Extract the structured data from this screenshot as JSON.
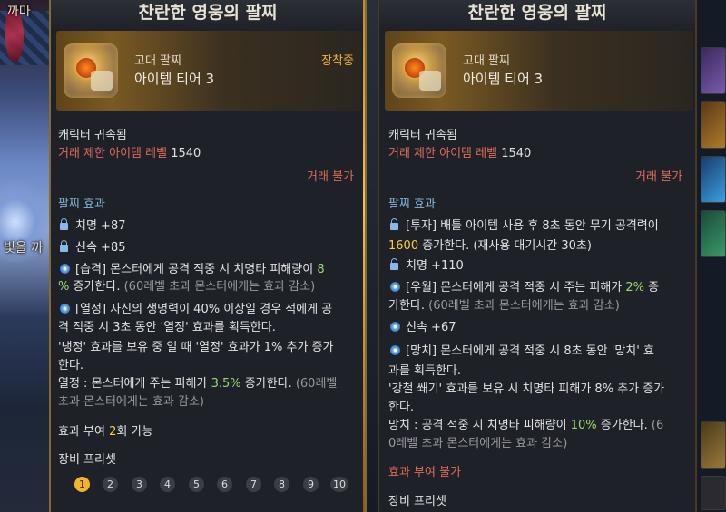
{
  "background": {
    "left_text_top": "까마",
    "left_text_mid": "빛을 까"
  },
  "left_panel": {
    "title": "찬란한 영웅의 팔찌",
    "grade": "고대 팔찌",
    "tier": "아이템 티어 3",
    "equipped": "장착중",
    "bound": "캐릭터 귀속됨",
    "trade_limit_label": "거래 제한 아이템 레벨",
    "trade_limit_value": "1540",
    "trade_status": "거래 불가",
    "effects_title": "팔찌 효과",
    "stat1": "치명 +87",
    "stat2": "신속 +85",
    "effect1_line1_a": "[습격] 몬스터에게 공격 적중 시 치명타 피해량이 ",
    "effect1_line1_b": "8",
    "effect1_line2_a": "%",
    "effect1_line2_b": " 증가한다.",
    "effect1_line2_c": " (60레벨 초과 몬스터에게는 효과 감소)",
    "effect2_line1": "[열정] 자신의 생명력이 40% 이상일 경우 적에게 공",
    "effect2_line2": "격 적중 시 3초 동안 '열정' 효과를 획득한다.",
    "effect2_line3": "'냉정' 효과를 보유 중 일 때 '열정' 효과가 1% 추가 증가",
    "effect2_line4": "한다.",
    "effect2_line5_a": "열정 : 몬스터에게 주는 피해가 ",
    "effect2_line5_b": "3.5%",
    "effect2_line5_c": " 증가한다.",
    "effect2_line5_d": " (60레벨",
    "effect2_line6": "초과 몬스터에게는 효과 감소)",
    "grant_a": "효과 부여 ",
    "grant_b": "2",
    "grant_c": "회 가능",
    "preset_title": "장비 프리셋",
    "presets": [
      "1",
      "2",
      "3",
      "4",
      "5",
      "6",
      "7",
      "8",
      "9",
      "10"
    ]
  },
  "right_panel": {
    "title": "찬란한 영웅의 팔찌",
    "grade": "고대 팔찌",
    "tier": "아이템 티어 3",
    "bound": "캐릭터 귀속됨",
    "trade_limit_label": "거래 제한 아이템 레벨",
    "trade_limit_value": "1540",
    "trade_status": "거래 불가",
    "effects_title": "팔찌 효과",
    "effect1_line1": "[투자] 배틀 아이템 사용 후 8초 동안 무기 공격력이",
    "effect1_line2_a": "1600",
    "effect1_line2_b": " 증가한다. (재사용 대기시간 30초)",
    "stat1": "치명 +110",
    "effect2_line1_a": "[우월] 몬스터에게 공격 적중 시 주는 피해가 ",
    "effect2_line1_b": "2%",
    "effect2_line1_c": " 증",
    "effect2_line2_a": "가한다.",
    "effect2_line2_b": " (60레벨 초과 몬스터에게는 효과 감소)",
    "stat2": "신속 +67",
    "effect3_line1": "[망치] 몬스터에게 공격 적중 시 8초 동안 '망치' 효",
    "effect3_line2": "과를 획득한다.",
    "effect3_line3": "'강철 쐐기' 효과를 보유 시 치명타 피해가 8% 추가 증가",
    "effect3_line4": "한다.",
    "effect3_line5_a": "망치 : 공격 적중 시 치명타 피해량이 ",
    "effect3_line5_b": "10%",
    "effect3_line5_c": " 증가한다.",
    "effect3_line5_d": " (6",
    "effect3_line6": "0레벨 초과 몬스터에게는 효과 감소)",
    "grant_disabled": "효과 부여 불가",
    "preset_title": "장비 프리셋"
  },
  "colors": {
    "red_text": "#e06a5a",
    "green_value": "#9ad86a",
    "gold_value": "#ffcc33",
    "equipped": "#f0b43a",
    "active_preset": "#f2b42a"
  },
  "active_preset": "1"
}
